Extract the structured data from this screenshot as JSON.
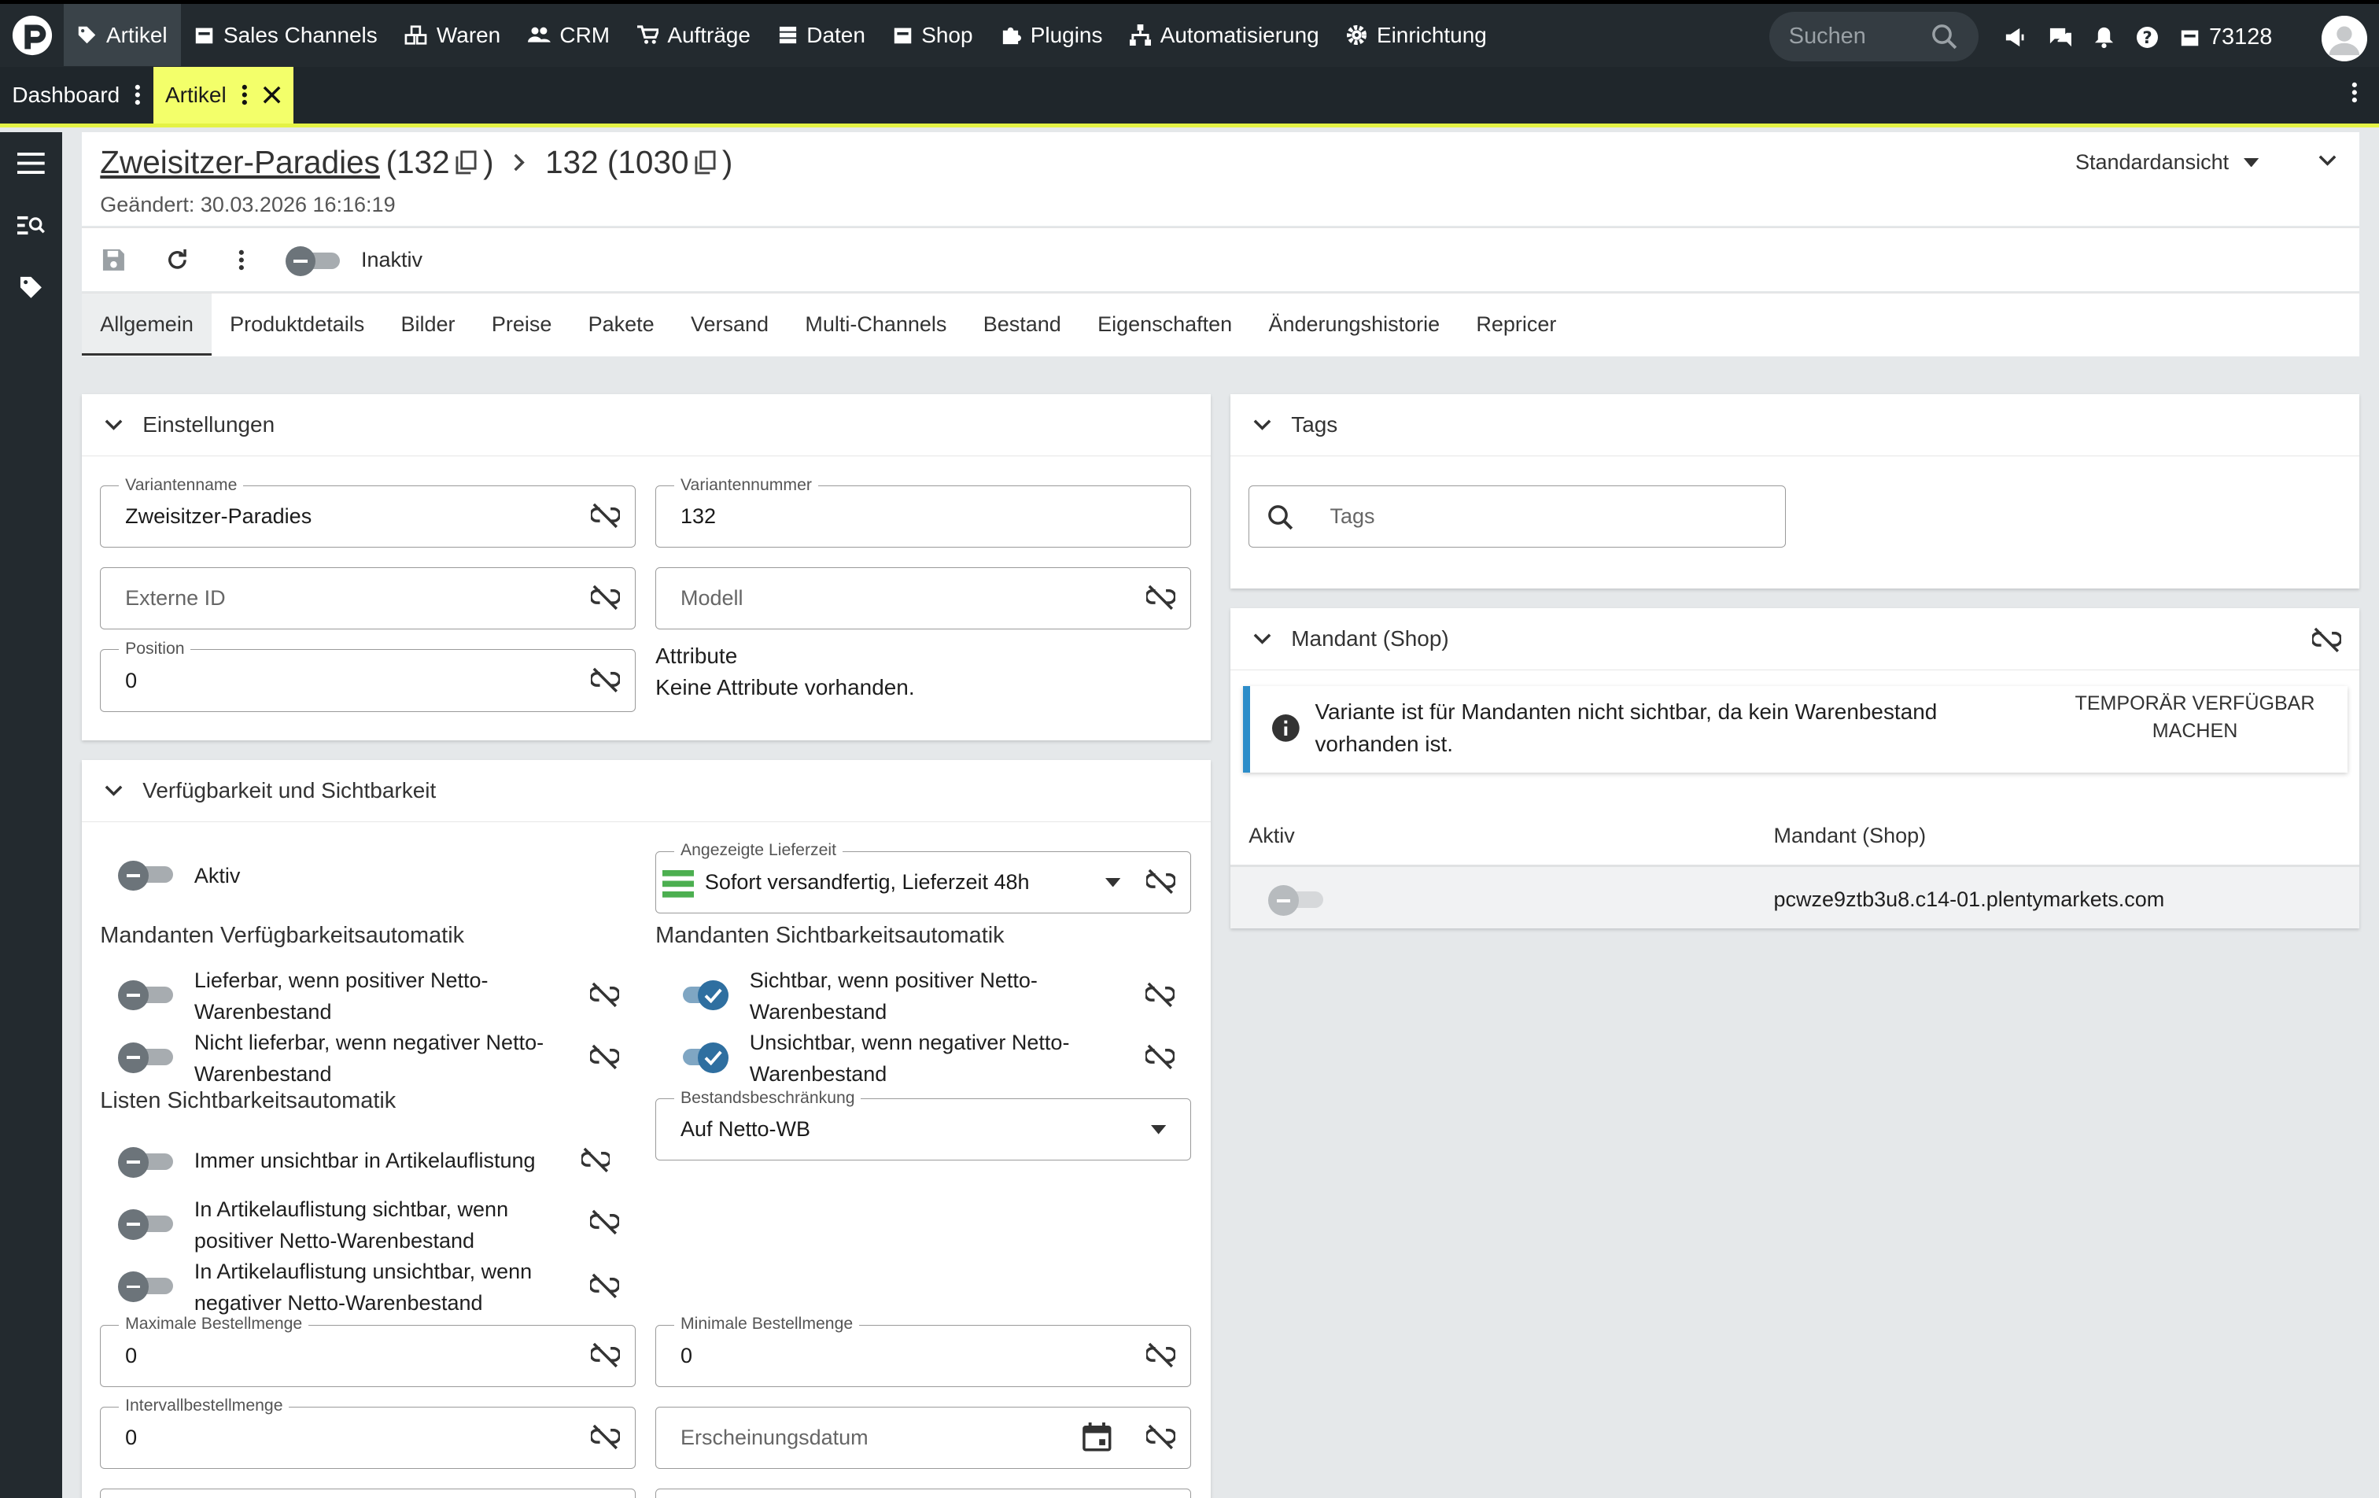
{
  "topnav": {
    "items": [
      "Artikel",
      "Sales Channels",
      "Waren",
      "CRM",
      "Aufträge",
      "Daten",
      "Shop",
      "Plugins",
      "Automatisierung",
      "Einrichtung"
    ],
    "search_placeholder": "Suchen",
    "system_id": "73128"
  },
  "tabs": {
    "dashboard": "Dashboard",
    "artikel": "Artikel"
  },
  "header": {
    "title_link": "Zweisitzer-Paradies",
    "title_id": "(132",
    "title_paren": ")",
    "variant": "132 (1030",
    "variant_paren": ")",
    "changed": "Geändert: 30.03.2026 16:16:19",
    "view": "Standardansicht"
  },
  "toolbar": {
    "status_label": "Inaktiv"
  },
  "subtabs": [
    "Allgemein",
    "Produktdetails",
    "Bilder",
    "Preise",
    "Pakete",
    "Versand",
    "Multi-Channels",
    "Bestand",
    "Eigenschaften",
    "Änderungshistorie",
    "Repricer"
  ],
  "settings": {
    "title": "Einstellungen",
    "variantenname_label": "Variantenname",
    "variantenname": "Zweisitzer-Paradies",
    "variantennummer_label": "Variantennummer",
    "variantennummer": "132",
    "externe_id_placeholder": "Externe ID",
    "modell_placeholder": "Modell",
    "position_label": "Position",
    "position": "0",
    "attribute_label": "Attribute",
    "attribute_value": "Keine Attribute vorhanden."
  },
  "availability": {
    "title": "Verfügbarkeit und Sichtbarkeit",
    "aktiv": "Aktiv",
    "lieferzeit_label": "Angezeigte Lieferzeit",
    "lieferzeit": "Sofort versandfertig, Lieferzeit 48h",
    "mandant_verf_title": "Mandanten Verfügbarkeitsautomatik",
    "lieferbar_1": "Lieferbar, wenn positiver Netto-",
    "lieferbar_2": "Warenbestand",
    "nicht_lieferbar_1": "Nicht lieferbar, wenn negativer Netto-",
    "nicht_lieferbar_2": "Warenbestand",
    "mandant_sicht_title": "Mandanten Sichtbarkeitsautomatik",
    "sichtbar_1": "Sichtbar, wenn positiver Netto-",
    "sichtbar_2": "Warenbestand",
    "unsichtbar_1": "Unsichtbar, wenn negativer Netto-",
    "unsichtbar_2": "Warenbestand",
    "listen_title": "Listen Sichtbarkeitsautomatik",
    "immer_unsichtbar": "Immer unsichtbar in Artikelauflistung",
    "list_sichtbar_1": "In Artikelauflistung sichtbar, wenn",
    "list_sichtbar_2": "positiver Netto-Warenbestand",
    "list_unsichtbar_1": "In Artikelauflistung unsichtbar, wenn",
    "list_unsichtbar_2": "negativer Netto-Warenbestand",
    "bestand_label": "Bestandsbeschränkung",
    "bestand": "Auf Netto-WB",
    "max_label": "Maximale Bestellmenge",
    "max": "0",
    "min_label": "Minimale Bestellmenge",
    "min": "0",
    "intervall_label": "Intervallbestellmenge",
    "intervall": "0",
    "erscheinung_placeholder": "Erscheinungsdatum"
  },
  "tags": {
    "title": "Tags",
    "placeholder": "Tags"
  },
  "mandant": {
    "title": "Mandant (Shop)",
    "info_1": "Variante ist für Mandanten nicht sichtbar, da kein Warenbestand",
    "info_2": "vorhanden ist.",
    "action_1": "TEMPORÄR VERFÜGBAR",
    "action_2": "MACHEN",
    "col_aktiv": "Aktiv",
    "col_mandant": "Mandant (Shop)",
    "row_shop": "pcwze9ztb3u8.c14-01.plentymarkets.com"
  },
  "colors": {
    "accent": "#f3ff6a",
    "nav_bg": "#232a2f",
    "info": "#2d8dc9",
    "toggle_on": "#2f6fa0",
    "green_icon": "#4caf50"
  }
}
